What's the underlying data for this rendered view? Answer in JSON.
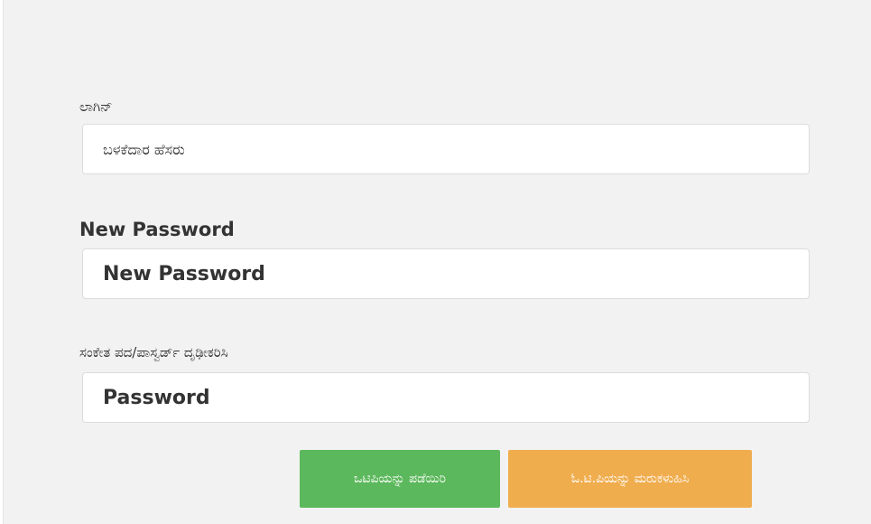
{
  "login": {
    "label": "ಲಾಗಿನ್",
    "username_placeholder": "ಬಳಕೆದಾರ ಹೆಸರು"
  },
  "new_password": {
    "label": "New Password",
    "placeholder": "New Password"
  },
  "confirm_password": {
    "label": "ಸಂಕೇತ ಪದ/ಪಾಸ್ವರ್ಡ್ ದೃಢೀಕರಿಸಿ",
    "placeholder": "Password"
  },
  "buttons": {
    "get_otp": "ಒಟಿಪಿಯನ್ನು ಪಡೆಯಿರಿ",
    "resend_otp": "ಓ.ಟಿ.ಪಿಯನ್ನು ಮರುಕಳುಹಿಸಿ"
  },
  "colors": {
    "panel_background": "#f2f2f2",
    "get_otp_button": "#5cb85c",
    "resend_otp_button": "#f0ad4e"
  }
}
